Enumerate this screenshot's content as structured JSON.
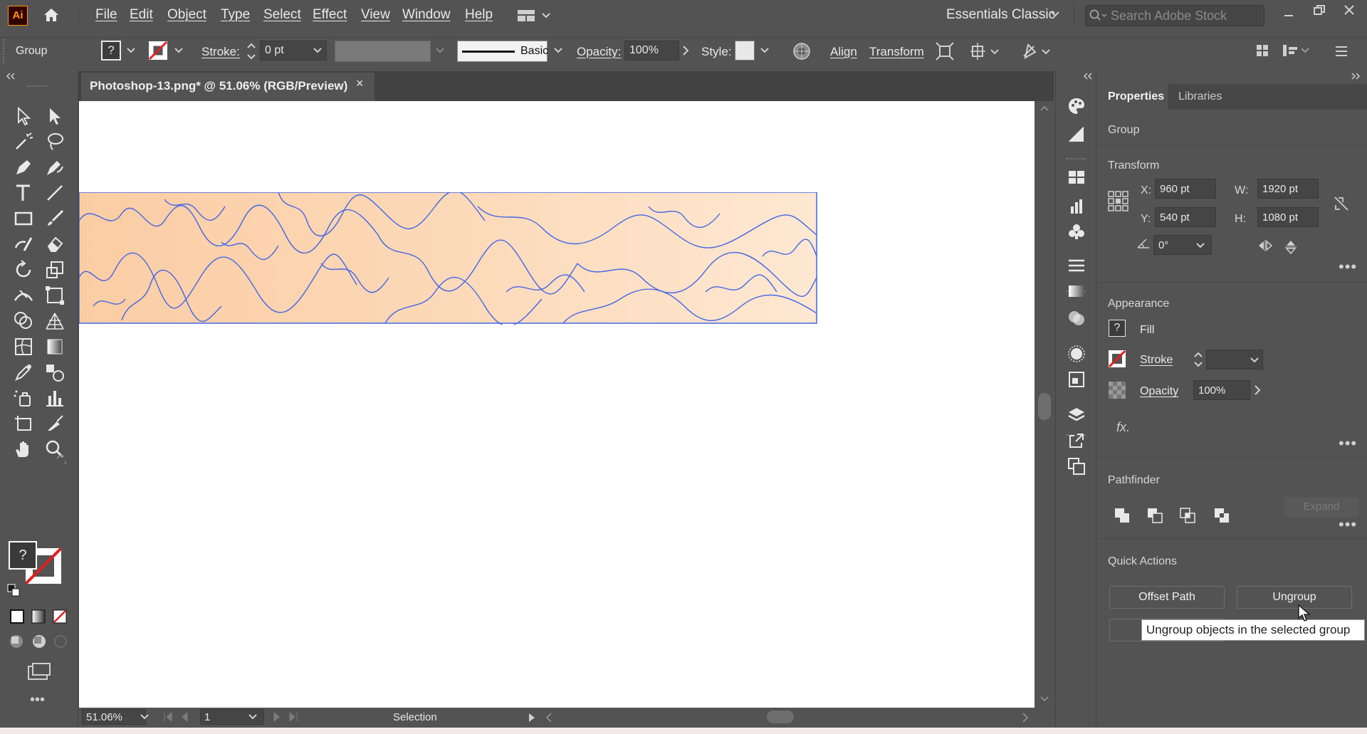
{
  "app": {
    "logo_text": "Ai"
  },
  "menu": [
    "File",
    "Edit",
    "Object",
    "Type",
    "Select",
    "Effect",
    "View",
    "Window",
    "Help"
  ],
  "workspace": "Essentials Classic",
  "search": {
    "placeholder": "Search Adobe Stock"
  },
  "control": {
    "selection_type": "Group",
    "fill_label": "?",
    "stroke_label": "Stroke:",
    "stroke_value": "0 pt",
    "brush_label": "Basic",
    "opacity_label": "Opacity:",
    "opacity_value": "100%",
    "style_label": "Style:",
    "align_label": "Align",
    "transform_label": "Transform"
  },
  "document": {
    "tab_title": "Photoshop-13.png* @ 51.06% (RGB/Preview)",
    "close": "×"
  },
  "colors": {
    "art_gradient_start": "#fbcfa8",
    "art_gradient_end": "#fde6cc",
    "path_stroke": "#4466e6",
    "accent_red": "#e02020"
  },
  "status": {
    "zoom": "51.06%",
    "artboard": "1",
    "tool": "Selection"
  },
  "panel": {
    "tabs": [
      "Properties",
      "Libraries"
    ],
    "active_tab": "Properties",
    "selection_type": "Group",
    "transform": {
      "title": "Transform",
      "x_label": "X:",
      "x": "960 pt",
      "y_label": "Y:",
      "y": "540 pt",
      "w_label": "W:",
      "w": "1920 pt",
      "h_label": "H:",
      "h": "1080 pt",
      "angle": "0°"
    },
    "appearance": {
      "title": "Appearance",
      "fill_label": "Fill",
      "fill_swatch": "?",
      "stroke_label": "Stroke",
      "opacity_label": "Opacity",
      "opacity_value": "100%",
      "fx": "fx."
    },
    "pathfinder": {
      "title": "Pathfinder",
      "expand_label": "Expand"
    },
    "quick_actions": {
      "title": "Quick Actions",
      "offset_path": "Offset Path",
      "ungroup": "Ungroup"
    },
    "more": "•••"
  },
  "tooltip": "Ungroup objects in the selected group",
  "toolbar_more": "•••"
}
